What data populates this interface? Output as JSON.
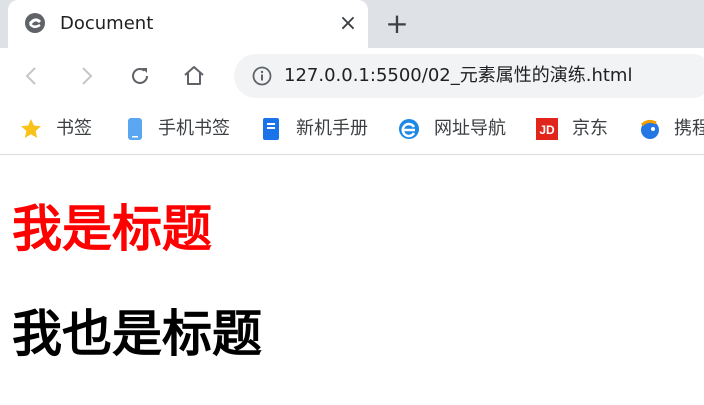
{
  "browser": {
    "tab": {
      "title": "Document",
      "close_glyph": "×"
    },
    "new_tab_glyph": "+",
    "address": {
      "url": "127.0.0.1:5500/02_元素属性的演练.html"
    },
    "bookmarks": [
      {
        "label": "书签",
        "icon": "star-icon"
      },
      {
        "label": "手机书签",
        "icon": "phone-icon"
      },
      {
        "label": "新机手册",
        "icon": "book-icon"
      },
      {
        "label": "网址导航",
        "icon": "browser-e-icon"
      },
      {
        "label": "京东",
        "icon": "jd-icon"
      },
      {
        "label": "携程",
        "icon": "ctrip-icon"
      }
    ]
  },
  "page": {
    "heading1": "我是标题",
    "heading2": "我也是标题"
  },
  "colors": {
    "heading1": "#ff0000",
    "heading2": "#000000",
    "tabstrip": "#dee1e6",
    "omnibox": "#f1f3f4"
  }
}
